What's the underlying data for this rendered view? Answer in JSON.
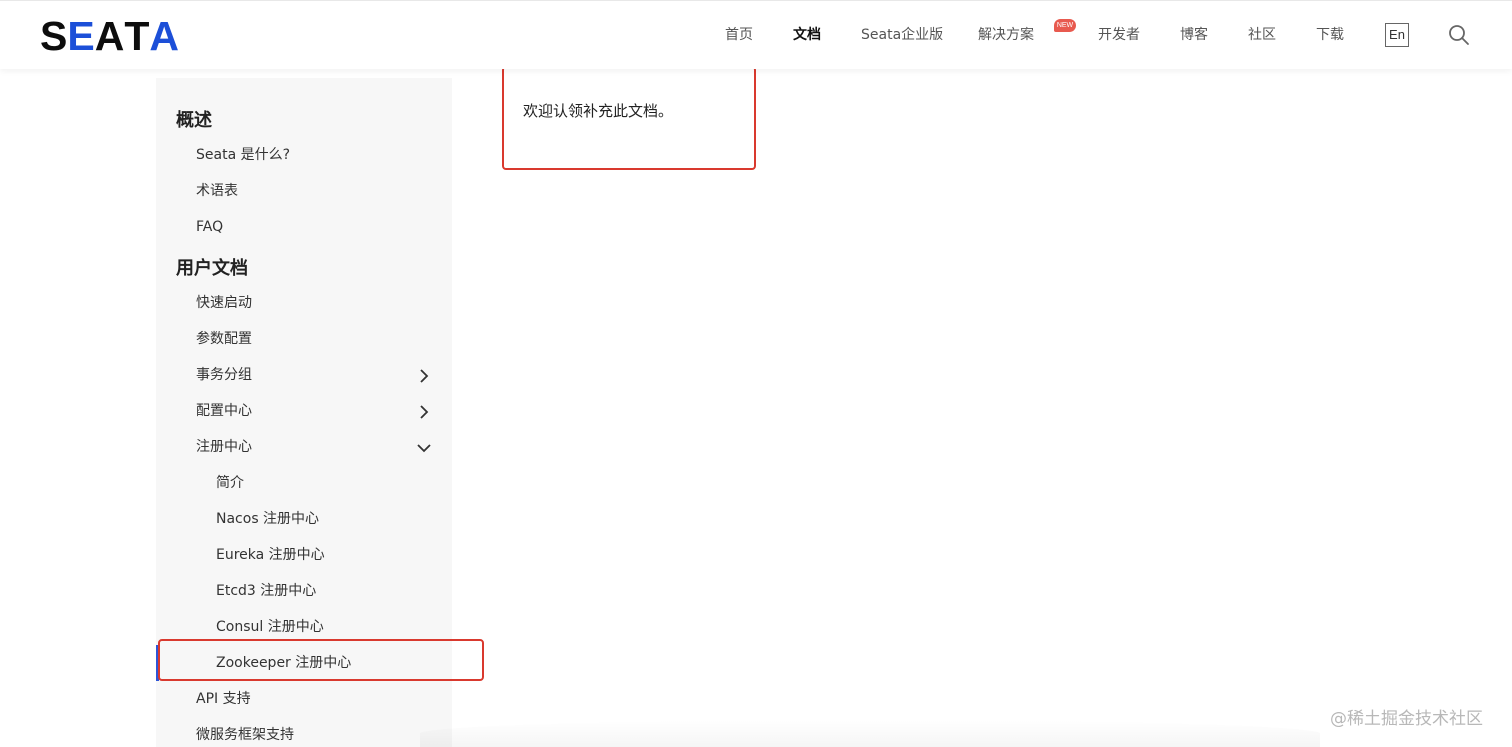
{
  "header": {
    "logo": {
      "s": "S",
      "e": "E",
      "a1": "A",
      "t": "T",
      "a2": "A"
    },
    "nav": [
      {
        "label": "首页",
        "active": false
      },
      {
        "label": "文档",
        "active": true
      },
      {
        "label": "Seata企业版",
        "active": false
      },
      {
        "label": "解决方案",
        "active": false
      },
      {
        "label": "开发者",
        "active": false
      },
      {
        "label": "博客",
        "active": false
      },
      {
        "label": "社区",
        "active": false
      },
      {
        "label": "下载",
        "active": false
      }
    ],
    "new_badge": "NEW",
    "lang_button": "En",
    "search_icon": "search-icon"
  },
  "sidebar": {
    "group_overview": "概述",
    "overview_items": [
      "Seata 是什么?",
      "术语表",
      "FAQ"
    ],
    "group_user_docs": "用户文档",
    "user_items": [
      "快速启动",
      "参数配置",
      "事务分组",
      "配置中心",
      "注册中心"
    ],
    "registry_children": [
      "简介",
      "Nacos 注册中心",
      "Eureka 注册中心",
      "Etcd3 注册中心",
      "Consul 注册中心",
      "Zookeeper 注册中心"
    ],
    "tail_items": [
      "API 支持",
      "微服务框架支持"
    ],
    "active_item": "Zookeeper 注册中心"
  },
  "content": {
    "text": "欢迎认领补充此文档。"
  },
  "watermark": "@稀土掘金技术社区",
  "colors": {
    "accent": "#1c4fd8",
    "highlight_border": "#d9392e",
    "badge": "#e85a4f",
    "sidebar_bg": "#f7f7f7"
  }
}
